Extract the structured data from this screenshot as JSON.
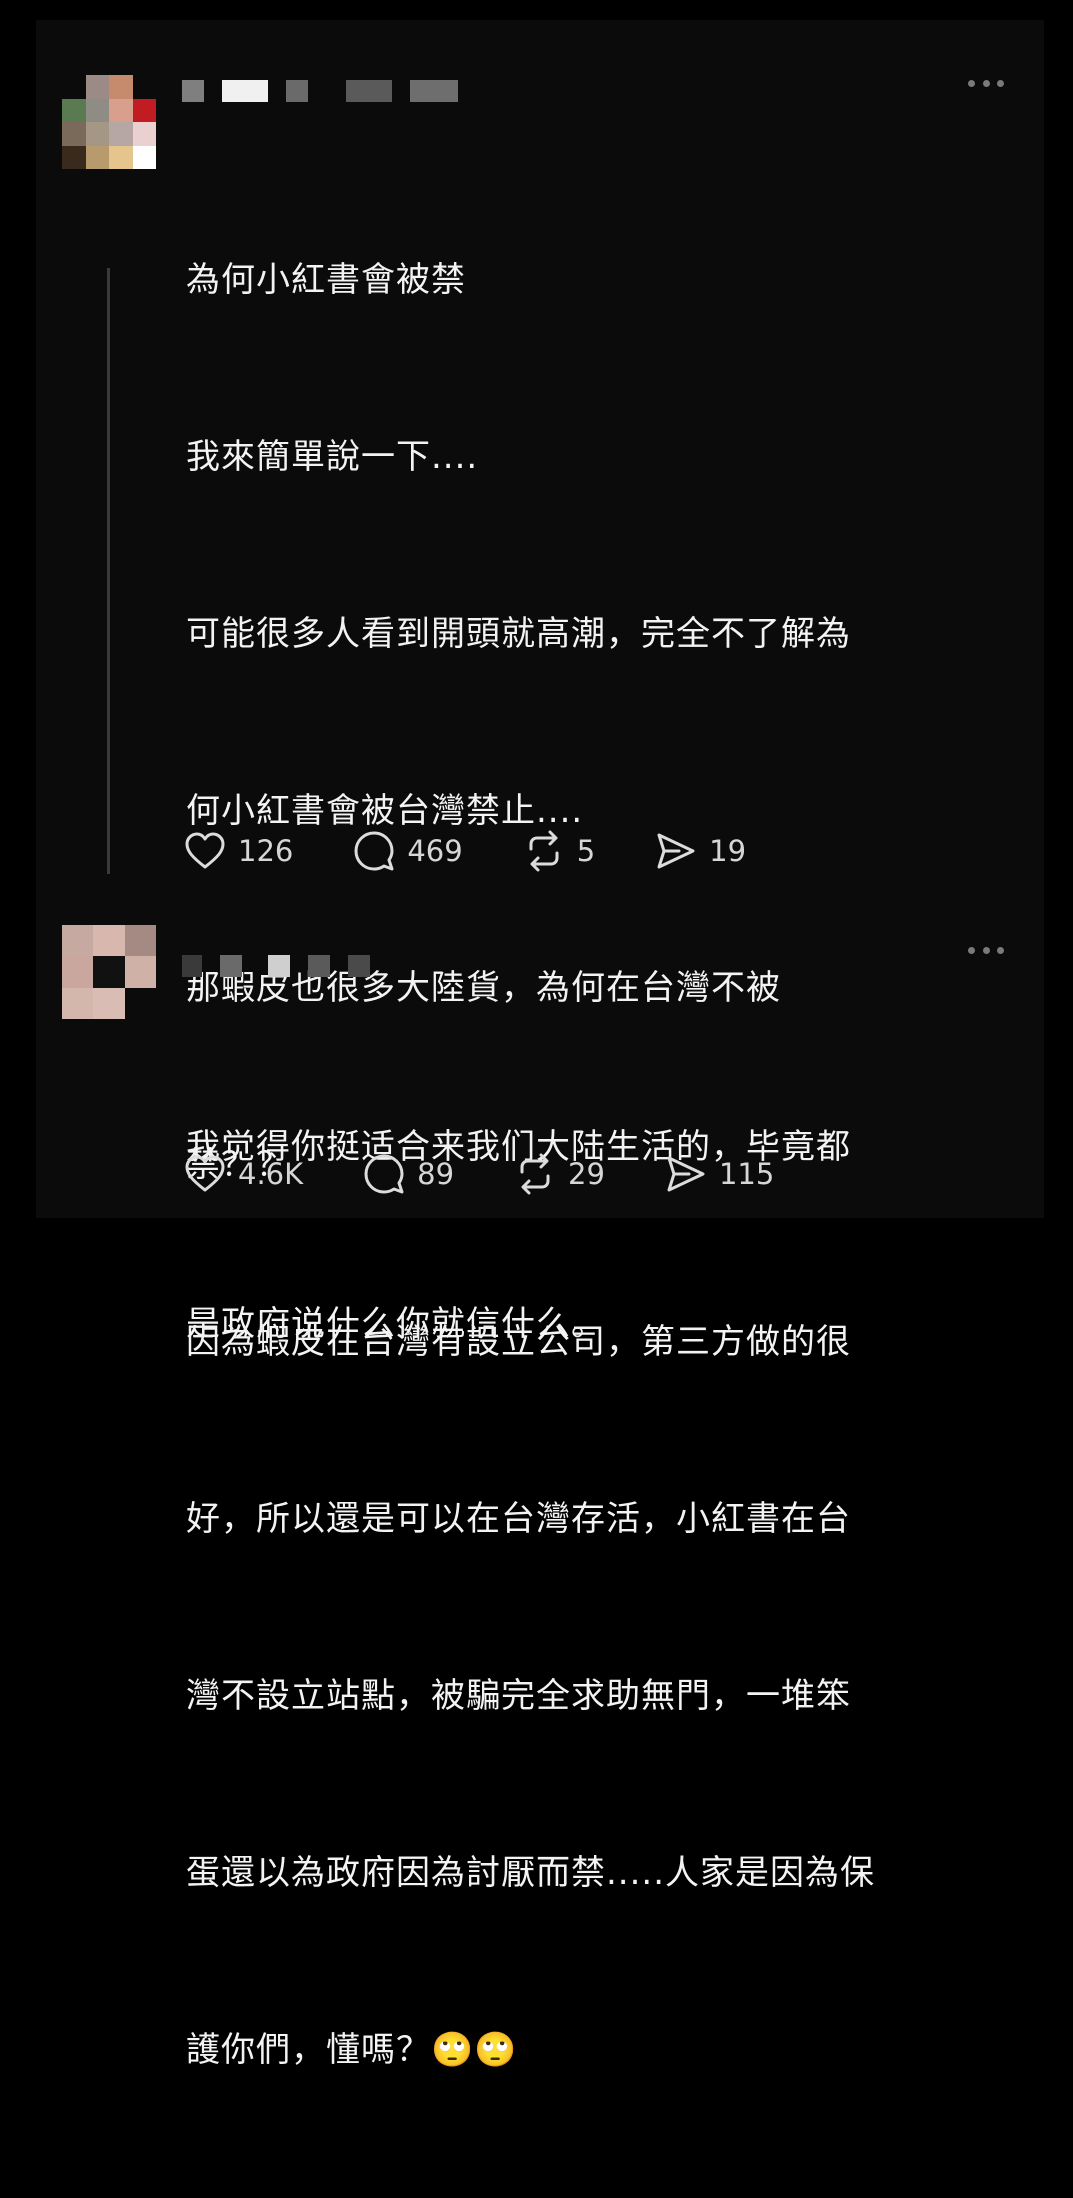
{
  "colors": {
    "background": "#000000",
    "panel": "#0b0b0b",
    "text": "#f3f3f3",
    "muted": "#d6d6d6",
    "divider": "#3a3a3a"
  },
  "posts": [
    {
      "author_redacted": true,
      "lines": [
        "為何小紅書會被禁",
        "我來簡單說一下....",
        "可能很多人看到開頭就高潮，完全不了解為",
        "何小紅書會被台灣禁止....",
        "那蝦皮也很多大陸貨，為何在台灣不被",
        "禁？？",
        "因為蝦皮在台灣有設立公司，第三方做的很",
        "好，所以還是可以在台灣存活，小紅書在台",
        "灣不設立站點，被騙完全求助無門，一堆笨",
        "蛋還以為政府因為討厭而禁.....人家是因為保",
        "護你們，懂嗎？🙄🙄"
      ],
      "actions": {
        "like": "126",
        "reply": "469",
        "repost": "5",
        "share": "19"
      }
    },
    {
      "author_redacted": true,
      "lines": [
        "我觉得你挺适合来我们大陆生活的，毕竟都",
        "是政府说什么你就信什么。"
      ],
      "actions": {
        "like": "4.6K",
        "reply": "89",
        "repost": "29",
        "share": "115"
      }
    }
  ],
  "icons": {
    "more": "more-icon",
    "like": "heart-icon",
    "reply": "reply-icon",
    "repost": "repost-icon",
    "share": "share-icon"
  }
}
